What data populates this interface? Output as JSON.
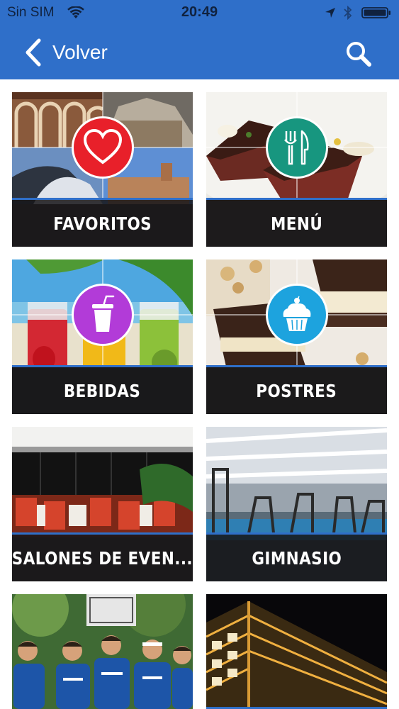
{
  "status_bar": {
    "carrier": "Sin SIM",
    "time": "20:49"
  },
  "nav": {
    "back_label": "Volver"
  },
  "colors": {
    "nav": "#2f6fc9",
    "favoritos_badge": "#e8202a",
    "menu_badge": "#17967f",
    "bebidas_badge": "#b23bd8",
    "postres_badge": "#1da3de"
  },
  "tiles": [
    {
      "label": "FAVORITOS",
      "icon": "heart-icon"
    },
    {
      "label": "MENÚ",
      "icon": "fork-knife-icon"
    },
    {
      "label": "BEBIDAS",
      "icon": "drink-cup-icon"
    },
    {
      "label": "POSTRES",
      "icon": "cupcake-icon"
    },
    {
      "label": "SALONES DE EVEN...",
      "icon": ""
    },
    {
      "label": "GIMNASIO",
      "icon": ""
    },
    {
      "label": "",
      "icon": ""
    },
    {
      "label": "",
      "icon": ""
    }
  ]
}
